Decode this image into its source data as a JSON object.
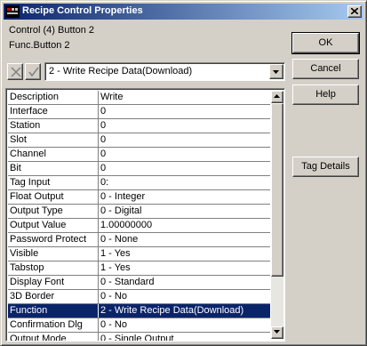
{
  "window": {
    "title": "Recipe Control Properties"
  },
  "info": {
    "control": "Control (4) Button 2",
    "func": "Func.Button 2"
  },
  "toolbar": {
    "function_select_value": "2 - Write Recipe Data(Download)"
  },
  "buttons": {
    "ok": "OK",
    "cancel": "Cancel",
    "help": "Help",
    "tag_details": "Tag Details"
  },
  "properties": [
    {
      "label": "Description",
      "value": "Write"
    },
    {
      "label": "Interface",
      "value": "0"
    },
    {
      "label": "Station",
      "value": "0"
    },
    {
      "label": "Slot",
      "value": "0"
    },
    {
      "label": "Channel",
      "value": "0"
    },
    {
      "label": "Bit",
      "value": "0"
    },
    {
      "label": "Tag Input",
      "value": "0:"
    },
    {
      "label": "Float Output",
      "value": "0 - Integer"
    },
    {
      "label": "Output Type",
      "value": "0 - Digital"
    },
    {
      "label": "Output Value",
      "value": "1.00000000"
    },
    {
      "label": "Password Protect",
      "value": "0 - None"
    },
    {
      "label": "Visible",
      "value": "1 - Yes"
    },
    {
      "label": "Tabstop",
      "value": "1 - Yes"
    },
    {
      "label": "Display Font",
      "value": "0 - Standard"
    },
    {
      "label": "3D Border",
      "value": "0 - No"
    },
    {
      "label": "Function",
      "value": "2 - Write Recipe Data(Download)",
      "selected": true
    },
    {
      "label": "Confirmation Dlg",
      "value": "0 - No"
    },
    {
      "label": "Output Mode",
      "value": "0 - Single Output"
    }
  ],
  "icons": {
    "app": "app-icon",
    "close": "close-icon",
    "cancel_edit": "x-icon",
    "accept_edit": "checkmark-icon",
    "dropdown": "chevron-down-icon",
    "scroll_up": "arrow-up-icon",
    "scroll_down": "arrow-down-icon"
  },
  "colors": {
    "titlebar_start": "#0a246a",
    "titlebar_end": "#a6caf0",
    "selection": "#0a246a",
    "face": "#d4d0c8"
  }
}
